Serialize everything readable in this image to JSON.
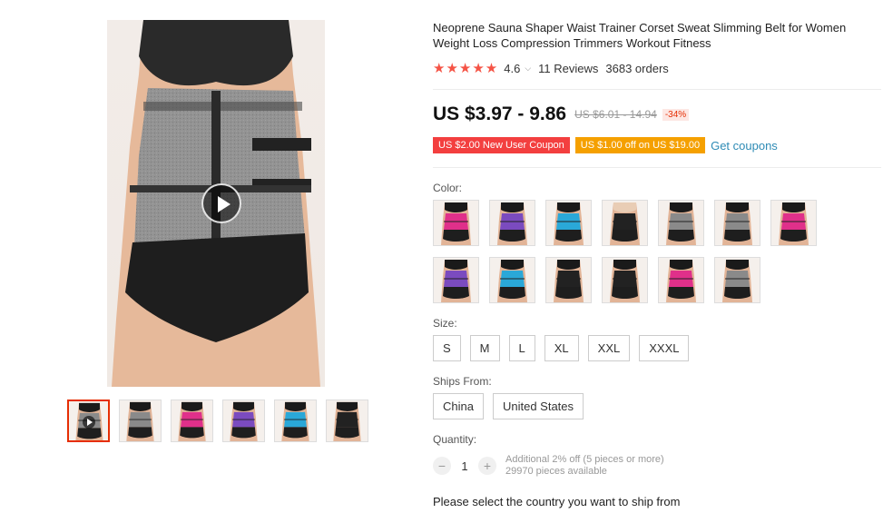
{
  "product": {
    "title": "Neoprene Sauna Shaper Waist Trainer Corset Sweat Slimming Belt for Women Weight Loss Compression Trimmers Workout Fitness",
    "rating_stars": "★★★★★",
    "rating": "4.6",
    "rating_chevron": "⌵",
    "reviews": "11 Reviews",
    "orders": "3683 orders"
  },
  "price": {
    "current": "US $3.97 - 9.86",
    "original": "US $6.01 - 14.94",
    "discount": "-34%"
  },
  "coupons": {
    "new_user": "US $2.00 New User Coupon",
    "store": "US $1.00 off on US $19.00",
    "get_link": "Get coupons"
  },
  "color": {
    "label": "Color:",
    "swatches": [
      {
        "belt": "#e0308a",
        "body": "#1a1a1a"
      },
      {
        "belt": "#7b4bbf",
        "body": "#1a1a1a"
      },
      {
        "belt": "#2aa8d8",
        "body": "#1a1a1a"
      },
      {
        "belt": "#222222",
        "body": "#e9cdb5"
      },
      {
        "belt": "#8a8a8a",
        "body": "#1a1a1a"
      },
      {
        "belt": "#8a8a8a",
        "body": "#1a1a1a"
      },
      {
        "belt": "#e0308a",
        "body": "#1a1a1a"
      },
      {
        "belt": "#7b4bbf",
        "body": "#1a1a1a"
      },
      {
        "belt": "#2aa8d8",
        "body": "#1a1a1a"
      },
      {
        "belt": "#222222",
        "body": "#1a1a1a"
      },
      {
        "belt": "#222222",
        "body": "#1a1a1a"
      },
      {
        "belt": "#e0308a",
        "body": "#1a1a1a"
      },
      {
        "belt": "#8a8a8a",
        "body": "#1a1a1a"
      }
    ]
  },
  "size": {
    "label": "Size:",
    "options": [
      "S",
      "M",
      "L",
      "XL",
      "XXL",
      "XXXL"
    ]
  },
  "ships_from": {
    "label": "Ships From:",
    "options": [
      "China",
      "United States"
    ]
  },
  "quantity": {
    "label": "Quantity:",
    "value": "1",
    "minus": "−",
    "plus": "+",
    "discount_note": "Additional 2% off (5 pieces or more)",
    "available": "29970 pieces available"
  },
  "shipping_message": "Please select the country you want to ship from",
  "gallery": {
    "thumbs": [
      {
        "belt": "#8a8a8a",
        "video": true
      },
      {
        "belt": "#8a8a8a",
        "video": false
      },
      {
        "belt": "#e0308a",
        "video": false
      },
      {
        "belt": "#7b4bbf",
        "video": false
      },
      {
        "belt": "#2aa8d8",
        "video": false
      },
      {
        "belt": "#222222",
        "video": false
      }
    ]
  }
}
